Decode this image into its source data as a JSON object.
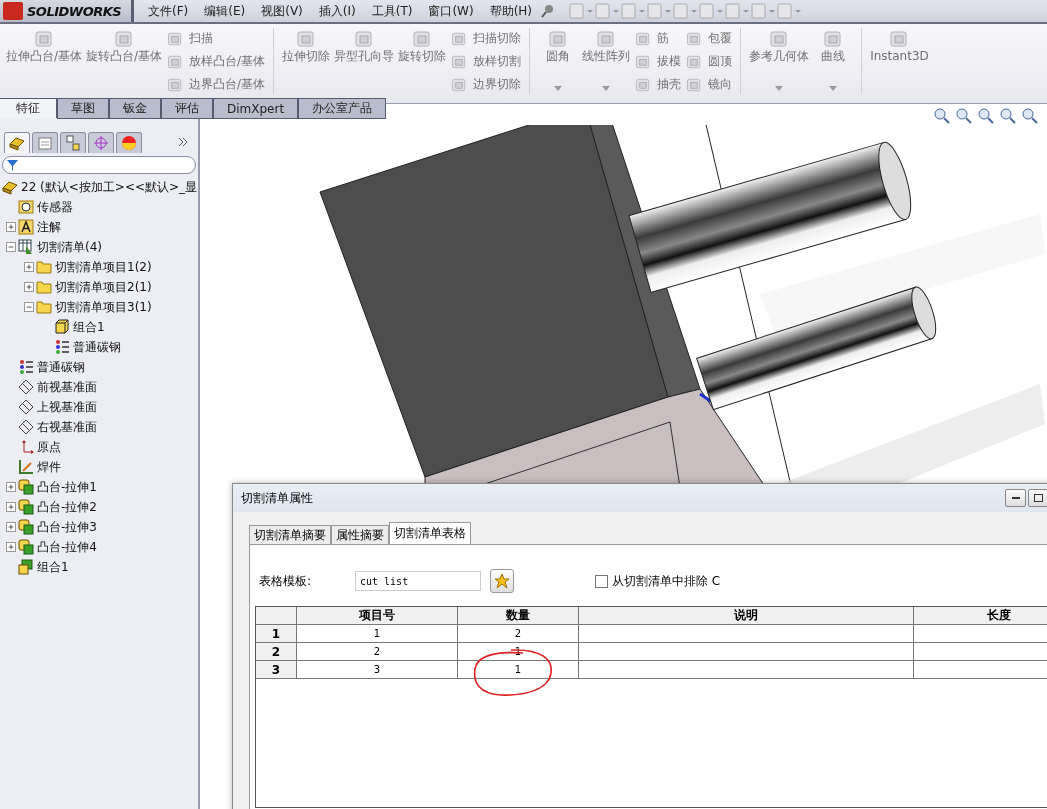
{
  "app": {
    "logo": "SOLIDWORKS"
  },
  "menu": [
    "文件(F)",
    "编辑(E)",
    "视图(V)",
    "插入(I)",
    "工具(T)",
    "窗口(W)",
    "帮助(H)"
  ],
  "ribbon": [
    {
      "kind": "large",
      "label": "拉伸凸台/基体",
      "menu": false
    },
    {
      "kind": "large",
      "label": "旋转凸台/基体",
      "menu": false
    },
    {
      "kind": "stack",
      "items": [
        "扫描",
        "放样凸台/基体",
        "边界凸台/基体"
      ]
    },
    {
      "kind": "divider"
    },
    {
      "kind": "large",
      "label": "拉伸切除",
      "menu": false
    },
    {
      "kind": "large",
      "label": "异型孔向导",
      "menu": false
    },
    {
      "kind": "large",
      "label": "旋转切除",
      "menu": false
    },
    {
      "kind": "stack",
      "items": [
        "扫描切除",
        "放样切割",
        "边界切除"
      ]
    },
    {
      "kind": "divider"
    },
    {
      "kind": "large",
      "label": "圆角",
      "menu": true
    },
    {
      "kind": "large",
      "label": "线性阵列",
      "menu": true
    },
    {
      "kind": "stack",
      "items": [
        "筋",
        "拔模",
        "抽壳"
      ]
    },
    {
      "kind": "stack",
      "items": [
        "包覆",
        "圆顶",
        "镜向"
      ]
    },
    {
      "kind": "divider"
    },
    {
      "kind": "large",
      "label": "参考几何体",
      "menu": true
    },
    {
      "kind": "large",
      "label": "曲线",
      "menu": true
    },
    {
      "kind": "divider"
    },
    {
      "kind": "large",
      "label": "Instant3D",
      "menu": false
    }
  ],
  "tabs": [
    {
      "label": "特征",
      "selected": true
    },
    {
      "label": "草图",
      "selected": false
    },
    {
      "label": "钣金",
      "selected": false
    },
    {
      "label": "评估",
      "selected": false
    },
    {
      "label": "DimXpert",
      "selected": false
    },
    {
      "label": "办公室产品",
      "selected": false
    }
  ],
  "tree": {
    "root": "22  (默认<按加工><<默认>_显",
    "items": [
      {
        "kind": "sensor",
        "label": "传感器"
      },
      {
        "kind": "annotation",
        "label": "注解",
        "expanded": false
      },
      {
        "kind": "cutlist",
        "label": "切割清单(4)",
        "expanded": true,
        "children": [
          {
            "kind": "folder",
            "label": "切割清单项目1(2)",
            "expanded": false
          },
          {
            "kind": "folder",
            "label": "切割清单项目2(1)",
            "expanded": false
          },
          {
            "kind": "folder",
            "label": "切割清单项目3(1)",
            "expanded": true,
            "children": [
              {
                "kind": "body",
                "label": "组合1"
              },
              {
                "kind": "material",
                "label": "普通碳钢"
              }
            ]
          }
        ]
      },
      {
        "kind": "material",
        "label": "普通碳钢"
      },
      {
        "kind": "plane",
        "label": "前视基准面"
      },
      {
        "kind": "plane",
        "label": "上视基准面"
      },
      {
        "kind": "plane",
        "label": "右视基准面"
      },
      {
        "kind": "origin",
        "label": "原点"
      },
      {
        "kind": "weldment",
        "label": "焊件"
      },
      {
        "kind": "feature",
        "label": "凸台-拉伸1",
        "expanded": false
      },
      {
        "kind": "feature",
        "label": "凸台-拉伸2",
        "expanded": false
      },
      {
        "kind": "feature",
        "label": "凸台-拉伸3",
        "expanded": false
      },
      {
        "kind": "feature",
        "label": "凸台-拉伸4",
        "expanded": false
      },
      {
        "kind": "combine",
        "label": "组合1"
      }
    ]
  },
  "dialog": {
    "title": "切割清单属性",
    "tabs": [
      {
        "label": "切割清单摘要",
        "selected": false
      },
      {
        "label": "属性摘要",
        "selected": false
      },
      {
        "label": "切割清单表格",
        "selected": true
      }
    ],
    "template_label": "表格模板:",
    "template_value": "cut list",
    "exclude": {
      "label": "从切割清单中排除 C",
      "checked": false
    },
    "table": {
      "columns": [
        "项目号",
        "数量",
        "说明",
        "长度"
      ],
      "rows": [
        {
          "header": "1",
          "cells": [
            "1",
            "2",
            "",
            ""
          ]
        },
        {
          "header": "2",
          "cells": [
            "2",
            "1",
            "",
            ""
          ]
        },
        {
          "header": "3",
          "cells": [
            "3",
            "1",
            "",
            ""
          ]
        }
      ]
    }
  }
}
